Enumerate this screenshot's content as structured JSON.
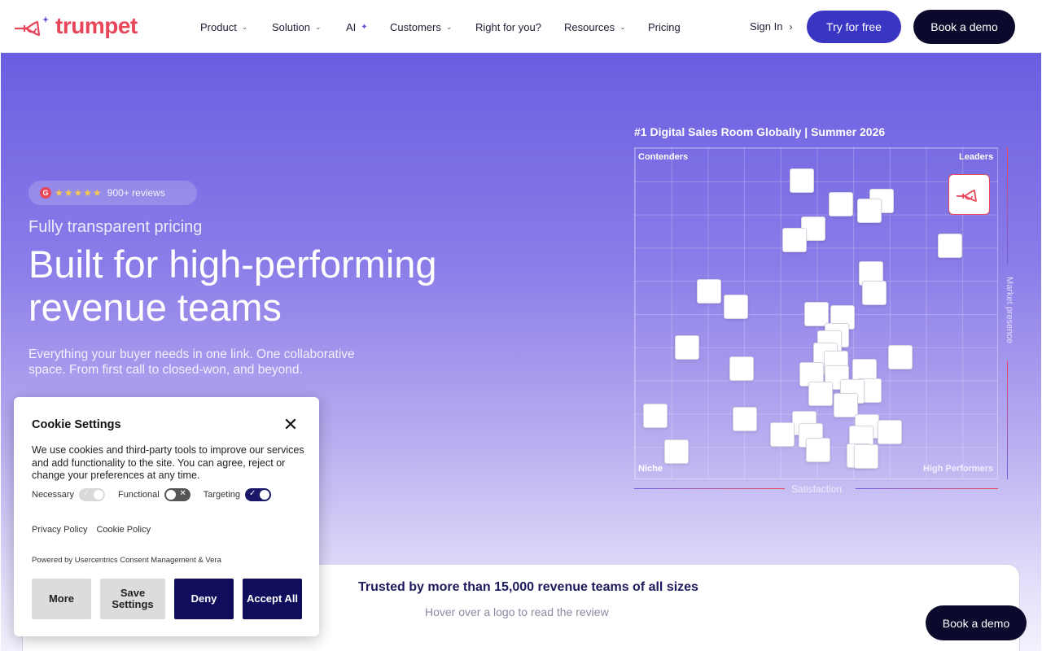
{
  "header": {
    "brand": "trumpet",
    "nav": [
      {
        "label": "Product",
        "has_dropdown": true
      },
      {
        "label": "Solution",
        "has_dropdown": true
      },
      {
        "label": "AI",
        "has_dropdown": false,
        "sparkle": true
      },
      {
        "label": "Customers",
        "has_dropdown": true
      },
      {
        "label": "Right for you?",
        "has_dropdown": false
      },
      {
        "label": "Resources",
        "has_dropdown": true
      },
      {
        "label": "Pricing",
        "has_dropdown": false
      }
    ],
    "sign_in": "Sign In",
    "try_free": "Try for free",
    "book_demo": "Book a demo"
  },
  "hero": {
    "rating_badge": "G",
    "stars": "★★★★★",
    "reviews": "900+ reviews",
    "eyebrow": "Fully transparent pricing",
    "headline": "Built for high-performing revenue teams",
    "subtext": "Everything your buyer needs in one link. One collaborative space. From first call to closed-won, and beyond."
  },
  "grid": {
    "title": "#1 Digital Sales Room Globally | Summer 2026",
    "quadrants": {
      "top_left": "Contenders",
      "top_right": "Leaders",
      "bottom_left": "Niche",
      "bottom_right": "High Performers"
    },
    "x_axis": "Satisfaction",
    "y_axis": "Market presence"
  },
  "trusted": {
    "title": "Trusted by more than 15,000 revenue teams of all sizes",
    "subtitle": "Hover over a logo to read the review"
  },
  "floating_cta": "Book a demo",
  "cookie": {
    "title": "Cookie Settings",
    "body": "We use cookies and third-party tools to improve our services and add functionality to the site. You can agree, reject or change your preferences at any time.",
    "toggles": [
      {
        "label": "Necessary",
        "state": "on-disabled"
      },
      {
        "label": "Functional",
        "state": "off"
      },
      {
        "label": "Targeting",
        "state": "on"
      }
    ],
    "privacy_policy": "Privacy Policy",
    "cookie_policy": "Cookie Policy",
    "powered_by": "Powered by Usercentrics Consent Management & Vera",
    "buttons": {
      "more": "More",
      "save": "Save Settings",
      "deny": "Deny",
      "accept": "Accept All"
    }
  },
  "colors": {
    "brand": "#e8465a",
    "primary": "#3b35c4",
    "dark": "#0c0a2c",
    "cookie_dark": "#100d5c"
  }
}
